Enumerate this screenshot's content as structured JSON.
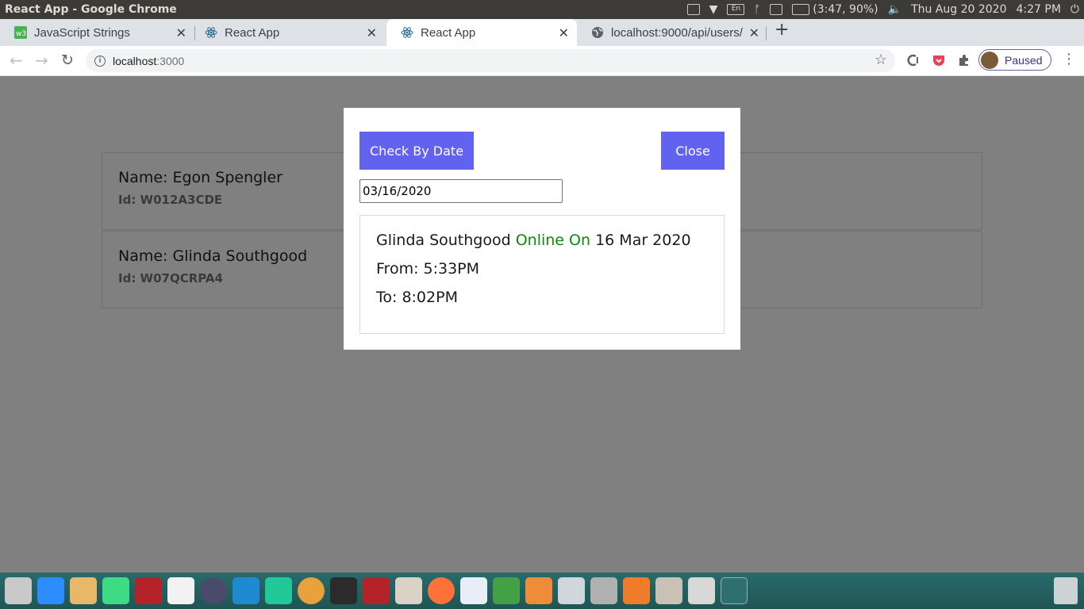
{
  "system_panel": {
    "window_title": "React App - Google Chrome",
    "keyboard_layout": "En",
    "battery": "(3:47, 90%)",
    "datetime": "Thu Aug 20 2020",
    "time": "4:27 PM"
  },
  "browser": {
    "tabs": [
      {
        "title": "JavaScript Strings",
        "favicon": "w3schools-icon",
        "active": false
      },
      {
        "title": "React App",
        "favicon": "react-icon",
        "active": false
      },
      {
        "title": "React App",
        "favicon": "react-icon",
        "active": true
      },
      {
        "title": "localhost:9000/api/users/",
        "favicon": "globe-icon",
        "active": false
      }
    ],
    "address": {
      "host": "localhost",
      "port": ":3000"
    },
    "profile_label": "Paused"
  },
  "page": {
    "users": [
      {
        "name": "Name: Egon Spengler",
        "id": "Id: W012A3CDE"
      },
      {
        "name": "Name: Glinda Southgood",
        "id": "Id: W07QCRPA4"
      }
    ]
  },
  "modal": {
    "check_button": "Check By Date",
    "close_button": "Close",
    "date_value": "03/16/2020",
    "result": {
      "person": "Glinda Southgood",
      "status": "Online On",
      "date": "16 Mar 2020",
      "from": "From: 5:33PM",
      "to": "To: 8:02PM"
    }
  },
  "colors": {
    "accent_button": "#6262f0",
    "online_green": "#0a8a0a",
    "overlay": "#808080"
  }
}
